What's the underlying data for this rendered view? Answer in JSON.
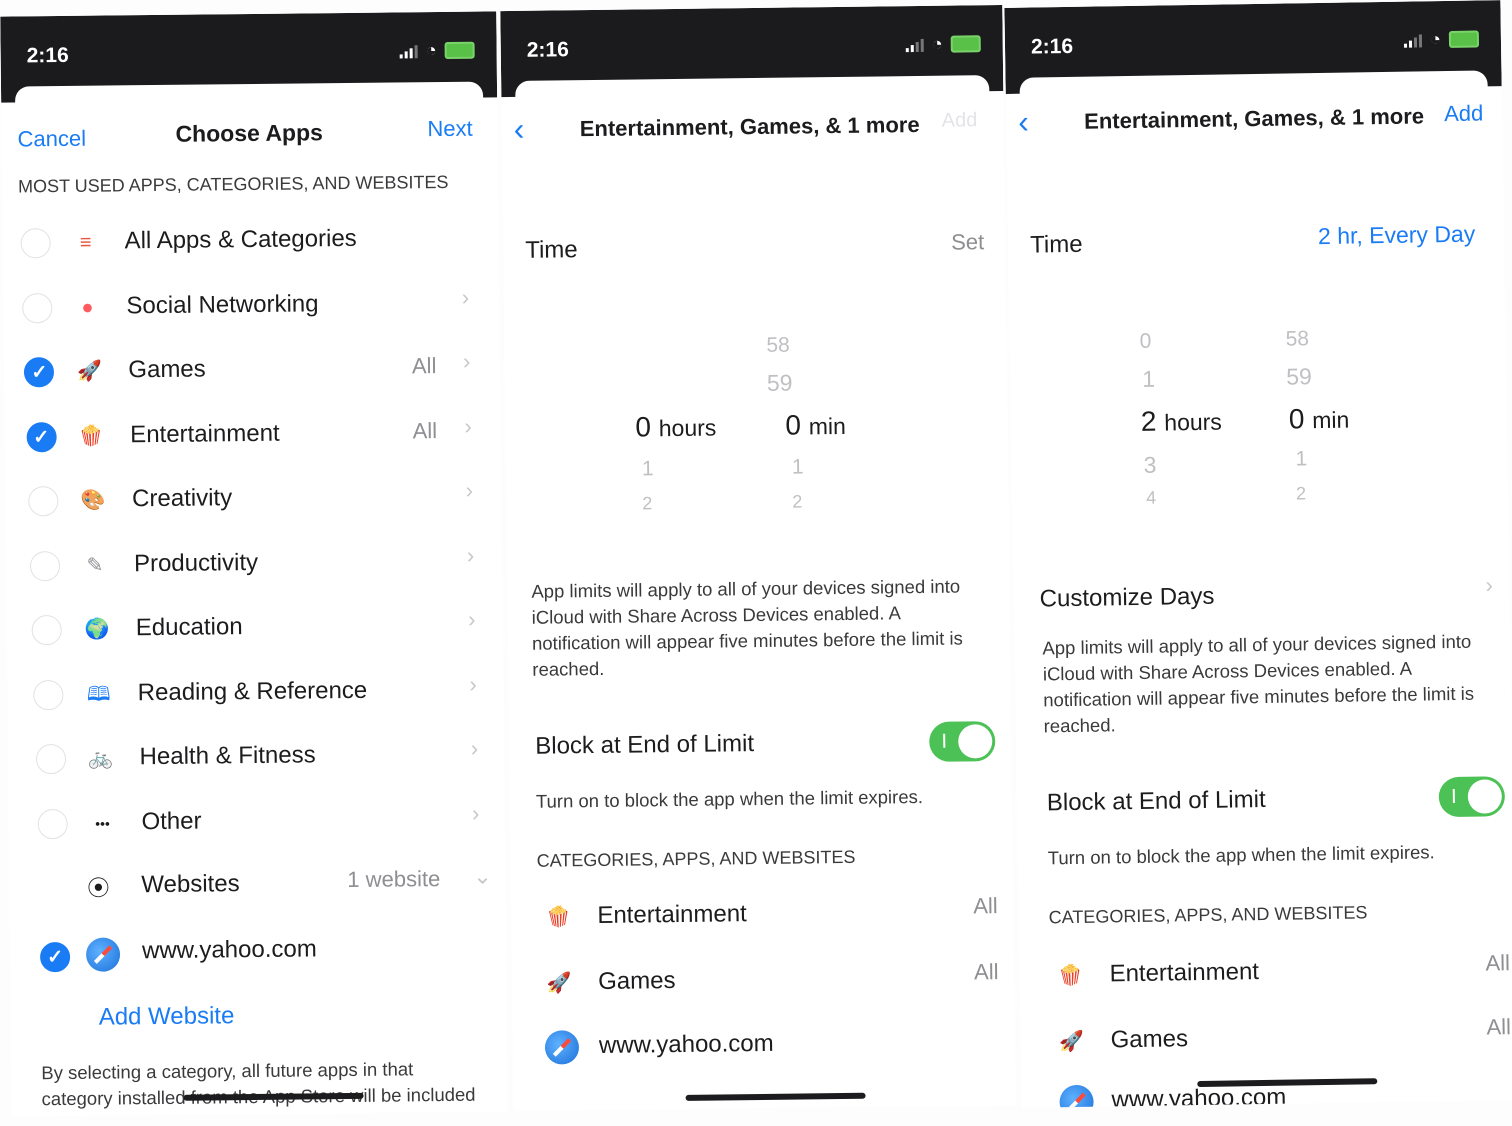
{
  "status": {
    "time": "2:16"
  },
  "screen1": {
    "nav": {
      "cancel": "Cancel",
      "title": "Choose Apps",
      "next": "Next"
    },
    "section_header": "MOST USED APPS, CATEGORIES, AND WEBSITES",
    "rows": [
      {
        "label": "All Apps & Categories",
        "checked": false,
        "icon": "layers-icon",
        "detail": ""
      },
      {
        "label": "Social Networking",
        "checked": false,
        "icon": "chat-bubbles-icon",
        "detail": ""
      },
      {
        "label": "Games",
        "checked": true,
        "icon": "rocket-icon",
        "detail": "All"
      },
      {
        "label": "Entertainment",
        "checked": true,
        "icon": "popcorn-icon",
        "detail": "All"
      },
      {
        "label": "Creativity",
        "checked": false,
        "icon": "palette-icon",
        "detail": ""
      },
      {
        "label": "Productivity",
        "checked": false,
        "icon": "pencil-icon",
        "detail": ""
      },
      {
        "label": "Education",
        "checked": false,
        "icon": "globe-icon",
        "detail": ""
      },
      {
        "label": "Reading & Reference",
        "checked": false,
        "icon": "book-icon",
        "detail": ""
      },
      {
        "label": "Health & Fitness",
        "checked": false,
        "icon": "bicycle-icon",
        "detail": ""
      },
      {
        "label": "Other",
        "checked": false,
        "icon": "ellipsis-icon",
        "detail": ""
      }
    ],
    "websites": {
      "label": "Websites",
      "detail": "1 website"
    },
    "site": {
      "label": "www.yahoo.com",
      "checked": true
    },
    "add_website": "Add Website",
    "footer": "By selecting a category, all future apps in that category installed from the App Store will be included in the limit."
  },
  "screen2": {
    "nav_title": "Entertainment, Games, & 1 more",
    "add": "Add",
    "time_label": "Time",
    "time_value": "Set",
    "picker": {
      "hours_above": [
        "",
        ""
      ],
      "hours_selected": "0",
      "hours_unit": "hours",
      "hours_below": [
        "1",
        "2"
      ],
      "min_above": [
        "58",
        "59"
      ],
      "min_selected": "0",
      "min_unit": "min",
      "min_below": [
        "1",
        "2"
      ]
    },
    "limits_note": "App limits will apply to all of your devices signed into iCloud with Share Across Devices enabled. A notification will appear five minutes before the limit is reached.",
    "block_label": "Block at End of Limit",
    "block_on": true,
    "block_note": "Turn on to block the app when the limit expires.",
    "list_header": "CATEGORIES, APPS, AND WEBSITES",
    "items": [
      {
        "label": "Entertainment",
        "detail": "All"
      },
      {
        "label": "Games",
        "detail": "All"
      },
      {
        "label": "www.yahoo.com",
        "detail": ""
      }
    ]
  },
  "screen3": {
    "nav_title": "Entertainment, Games, & 1 more",
    "add": "Add",
    "time_label": "Time",
    "time_value": "2 hr, Every Day",
    "picker": {
      "hours_above": [
        "0",
        "1"
      ],
      "hours_selected": "2",
      "hours_unit": "hours",
      "hours_below": [
        "3",
        "4"
      ],
      "min_above": [
        "58",
        "59"
      ],
      "min_selected": "0",
      "min_unit": "min",
      "min_below": [
        "1",
        "2"
      ]
    },
    "customize_days": "Customize Days",
    "limits_note": "App limits will apply to all of your devices signed into iCloud with Share Across Devices enabled. A notification will appear five minutes before the limit is reached.",
    "block_label": "Block at End of Limit",
    "block_on": true,
    "block_note": "Turn on to block the app when the limit expires.",
    "list_header": "CATEGORIES, APPS, AND WEBSITES",
    "items": [
      {
        "label": "Entertainment",
        "detail": "All"
      },
      {
        "label": "Games",
        "detail": "All"
      },
      {
        "label": "www.yahoo.com",
        "detail": ""
      }
    ]
  }
}
